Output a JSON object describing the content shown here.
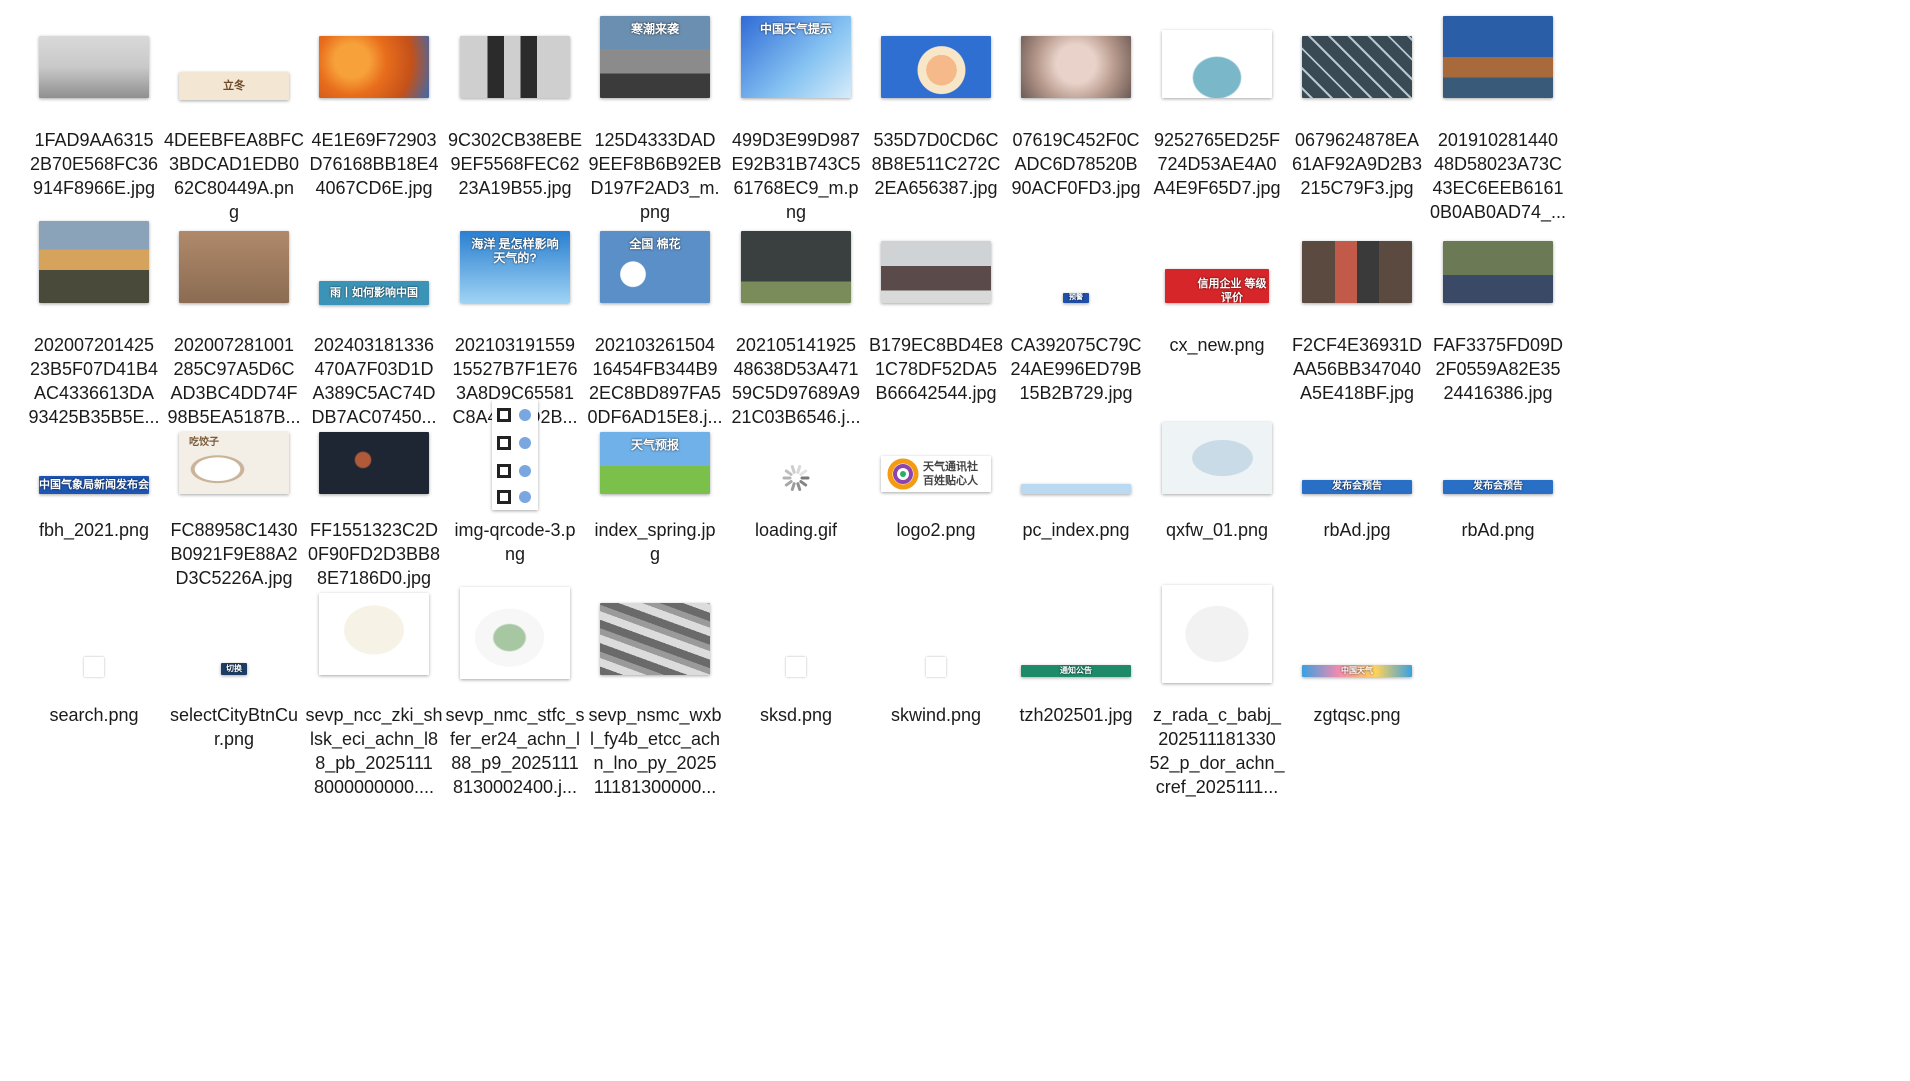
{
  "files": [
    {
      "name": "1FAD9AA63152B70E568FC36914F8966E.jpg",
      "caption": "1FAD9AA6315\n2B70E568FC36\n914F8966E.jpg",
      "thumb": "photo-fog",
      "colors": [
        "#c9c9c9",
        "#8f8f8f"
      ]
    },
    {
      "name": "4DEEBFEA8BFC3BDCAD1EDB062C80449A.png",
      "caption": "4DEEBFEA8BFC\n3BDCAD1EDB0\n62C80449A.pn\ng",
      "thumb": "banner-autumn",
      "colors": [
        "#f3e7d3",
        "#b9875a"
      ],
      "text": "立冬"
    },
    {
      "name": "4E1E69F72903D76168BB18E44067CD6E.jpg",
      "caption": "4E1E69F72903\nD76168BB18E4\n4067CD6E.jpg",
      "thumb": "photo-maple",
      "colors": [
        "#e86d1c",
        "#f7a13a"
      ]
    },
    {
      "name": "9C302CB38EBE9EF5568FEC6223A19B55.jpg",
      "caption": "9C302CB38EBE\n9EF5568FEC62\n23A19B55.jpg",
      "thumb": "photo-legs",
      "colors": [
        "#cfcfcf",
        "#2b2b2b"
      ]
    },
    {
      "name": "125D4333DAD9EEF8B6B92EBD197F2AD3_m.png",
      "caption": "125D4333DAD\n9EEF8B6B92EB\nD197F2AD3_m.\npng",
      "thumb": "photo-cyclists",
      "colors": [
        "#6a8fb0",
        "#3b3b3b"
      ],
      "text": "寒潮来袭"
    },
    {
      "name": "499D3E99D987E92B31B743C561768EC9_m.png",
      "caption": "499D3E99D987\nE92B31B743C5\n61768EC9_m.p\nng",
      "thumb": "weather-presenter",
      "colors": [
        "#2f6bd6",
        "#88c4f2"
      ],
      "text": "中国天气提示"
    },
    {
      "name": "535D7D0CD6C8B8E511C272C2EA656387.jpg",
      "caption": "535D7D0CD6C\n8B8E511C272C\n2EA656387.jpg",
      "thumb": "cartoon-sleep",
      "colors": [
        "#2f6fd1",
        "#f5b98a"
      ]
    },
    {
      "name": "07619C452F0CADC6D78520B90ACF0FD3.jpg",
      "caption": "07619C452F0C\nADC6D78520B\n90ACF0FD3.jpg",
      "thumb": "photo-hood",
      "colors": [
        "#b89a8d",
        "#e8d2c9"
      ]
    },
    {
      "name": "9252765ED25F724D53AE4A0A4E9F65D7.jpg",
      "caption": "9252765ED25F\n724D53AE4A0\nA4E9F65D7.jpg",
      "thumb": "cartoon-cold",
      "colors": [
        "#ffffff",
        "#7ab7c9"
      ]
    },
    {
      "name": "0679624878EA61AF92A9D2B3215C79F3.jpg",
      "caption": "0679624878EA\n61AF92A9D2B3\n215C79F3.jpg",
      "thumb": "photo-frost",
      "colors": [
        "#3a4a55",
        "#b7c6cf"
      ]
    },
    {
      "name": "20191028144048D58023A73C43EC6EEB61610B0AB0AD74_.jpg",
      "caption": "201910281440\n48D58023A73C\n43EC6EEB6161\n0B0AB0AD74_...",
      "thumb": "photo-palace",
      "colors": [
        "#2a5fa8",
        "#a86a3a"
      ]
    },
    {
      "name": "20200720142523B5F07D41B4AC4336613DA93425B35B5E.jpg",
      "caption": "202007201425\n23B5F07D41B4\nAC4336613DA\n93425B35B5E...",
      "thumb": "photo-sunset-temple",
      "colors": [
        "#8aa3b8",
        "#d6a35c"
      ]
    },
    {
      "name": "20200728100128... .jpg",
      "caption": "202007281001\n285C97A5D6C\nAD3BC4DD74F\n98B5EA5187B...",
      "thumb": "photo-dust",
      "colors": [
        "#b0896a",
        "#8b6c52"
      ]
    },
    {
      "name": "20240318133647... .png",
      "caption": "202403181336\n470A7F03D1D\nA389C5AC74D\nDB7AC07450...",
      "thumb": "banner-rain",
      "colors": [
        "#3b94b7",
        "#8fd0e0"
      ],
      "text": "雨丨如何影响中国"
    },
    {
      "name": "2021031915591552... .png",
      "caption": "202103191559\n15527B7F1E76\n3A8D9C65581\nC8A4873D2B...",
      "thumb": "ocean-weather",
      "colors": [
        "#2a7fd0",
        "#9fd3f4"
      ],
      "text": "海洋 是怎样影响 天气的?"
    },
    {
      "name": "20210326150416454... .jpg",
      "caption": "202103261504\n16454FB344B9\n2EC8BD897FA5\n0DF6AD15E8.j...",
      "thumb": "cotton",
      "colors": [
        "#5a8fc8",
        "#f2f2f2"
      ],
      "text": "全国 棉花"
    },
    {
      "name": "20210514192548638... .jpg",
      "caption": "202105141925\n48638D53A471\n59C5D97689A9\n21C03B6546.j...",
      "thumb": "storm",
      "colors": [
        "#3a3f3f",
        "#7a8c5a"
      ]
    },
    {
      "name": "B179EC8BD4E81C78DF52DA5B66642544.jpg",
      "caption": "B179EC8BD4E8\n1C78DF52DA5\nB66642544.jpg",
      "thumb": "photo-crowd-snow",
      "colors": [
        "#cfd3d6",
        "#5a4a4a"
      ]
    },
    {
      "name": "CA392075C79C24AE996ED79B15B2B729.jpg",
      "caption": "CA392075C79C\n24AE996ED79B\n15B2B729.jpg",
      "thumb": "small-tag",
      "colors": [
        "#1f4fa8"
      ],
      "text": "预警"
    },
    {
      "name": "cx_new.png",
      "caption": "cx_new.png",
      "thumb": "credit-banner",
      "colors": [
        "#d7262a",
        "#ffffff"
      ],
      "text": "信用企业 等级评价"
    },
    {
      "name": "F2CF4E36931DAA56BB347040A5E418BF.jpg",
      "caption": "F2CF4E36931D\nAA56BB347040\nA5E418BF.jpg",
      "thumb": "photo-people-coats",
      "colors": [
        "#5a4a40",
        "#c25a4a"
      ]
    },
    {
      "name": "FAF3375FD09D2F0559A82E3524416386.jpg",
      "caption": "FAF3375FD09D\n2F0559A82E35\n24416386.jpg",
      "thumb": "photo-scooter",
      "colors": [
        "#6b7a55",
        "#3a4a66"
      ]
    },
    {
      "name": "fbh_2021.png",
      "caption": "fbh_2021.png",
      "thumb": "strip-blue",
      "colors": [
        "#1d56b3"
      ],
      "text": "中国气象局新闻发布会"
    },
    {
      "name": "FC88958C1430B0921F9E88A2D3C5226A.jpg",
      "caption": "FC88958C1430\nB0921F9E88A2\nD3C5226A.jpg",
      "thumb": "illustration-bowl",
      "colors": [
        "#f4efe6",
        "#c9b49a"
      ],
      "text": "吃饺子"
    },
    {
      "name": "FF1551323C2D0F90FD2D3BB88E7186D0.jpg",
      "caption": "FF1551323C2D\n0F90FD2D3BB8\n8E7186D0.jpg",
      "thumb": "photo-moon",
      "colors": [
        "#1d2632",
        "#b05a3a"
      ]
    },
    {
      "name": "img-qrcode-3.png",
      "caption": "img-qrcode-3.p\nng",
      "thumb": "qr-tall",
      "colors": [
        "#ffffff",
        "#222222"
      ]
    },
    {
      "name": "index_spring.jpg",
      "caption": "index_spring.jp\ng",
      "thumb": "spring-banner",
      "colors": [
        "#6fb1e8",
        "#7bc04a"
      ],
      "text": "天气预报"
    },
    {
      "name": "loading.gif",
      "caption": "loading.gif",
      "thumb": "spinner",
      "colors": [
        "#999999"
      ]
    },
    {
      "name": "logo2.png",
      "caption": "logo2.png",
      "thumb": "logo",
      "colors": [
        "#ffffff"
      ],
      "text": "天气通讯社 百姓贴心人"
    },
    {
      "name": "pc_index.png",
      "caption": "pc_index.png",
      "thumb": "thin-strip",
      "colors": [
        "#bcd9f2"
      ]
    },
    {
      "name": "qxfw_01.png",
      "caption": "qxfw_01.png",
      "thumb": "map-china",
      "colors": [
        "#eef3f6",
        "#c9dbe6"
      ]
    },
    {
      "name": "rbAd.jpg",
      "caption": "rbAd.jpg",
      "thumb": "strip-rb",
      "colors": [
        "#2a6fc6"
      ],
      "text": "发布会预告"
    },
    {
      "name": "rbAd.png",
      "caption": "rbAd.png",
      "thumb": "strip-rb",
      "colors": [
        "#2a6fc6"
      ],
      "text": "发布会预告"
    },
    {
      "name": "search.png",
      "caption": "search.png",
      "thumb": "tiny-white",
      "colors": [
        "#ffffff"
      ]
    },
    {
      "name": "selectCityBtnCur.png",
      "caption": "selectCityBtnCu\nr.png",
      "thumb": "tiny-pill",
      "colors": [
        "#1c3d66"
      ],
      "text": "切换"
    },
    {
      "name": "sevp_ncc_zki_shlsk_eci_achn_l88_pb_20251118000000000.png",
      "caption": "sevp_ncc_zki_sh\nlsk_eci_achn_l8\n8_pb_2025111\n8000000000....",
      "thumb": "map-china-white",
      "colors": [
        "#ffffff",
        "#e0a050"
      ]
    },
    {
      "name": "sevp_nmc_stfc_sfer_er24_achn_l88_p9_20251118130002400.jpg",
      "caption": "sevp_nmc_stfc_s\nfer_er24_achn_l\n88_p9_2025111\n8130002400.j...",
      "thumb": "map-china-green",
      "colors": [
        "#ffffff",
        "#3ba34a"
      ]
    },
    {
      "name": "sevp_nsmc_wxbl_fy4b_etcc_achn_lno_py_202511181300000.jpg",
      "caption": "sevp_nsmc_wxb\nl_fy4b_etcc_ach\nn_lno_py_2025\n11181300000...",
      "thumb": "satellite",
      "colors": [
        "#6a6a6a",
        "#dcdcdc"
      ]
    },
    {
      "name": "sksd.png",
      "caption": "sksd.png",
      "thumb": "tiny-white",
      "colors": [
        "#ffffff"
      ]
    },
    {
      "name": "skwind.png",
      "caption": "skwind.png",
      "thumb": "tiny-white",
      "colors": [
        "#ffffff"
      ]
    },
    {
      "name": "tzh202501.jpg",
      "caption": "tzh202501.jpg",
      "thumb": "strip-green",
      "colors": [
        "#1f8a6a"
      ],
      "text": "通知公告"
    },
    {
      "name": "z_rada_c_babj_20251118133052_p_dor_achn_cref_2025111.png",
      "caption": "z_rada_c_babj_\n202511181330\n52_p_dor_achn_\ncref_2025111...",
      "thumb": "radar-map",
      "colors": [
        "#ffffff",
        "#4caf50"
      ]
    },
    {
      "name": "zgtqsc.png",
      "caption": "zgtqsc.png",
      "thumb": "strip-colorful",
      "colors": [
        "#3aa0e0",
        "#f28ab0"
      ],
      "text": "中国天气"
    }
  ]
}
